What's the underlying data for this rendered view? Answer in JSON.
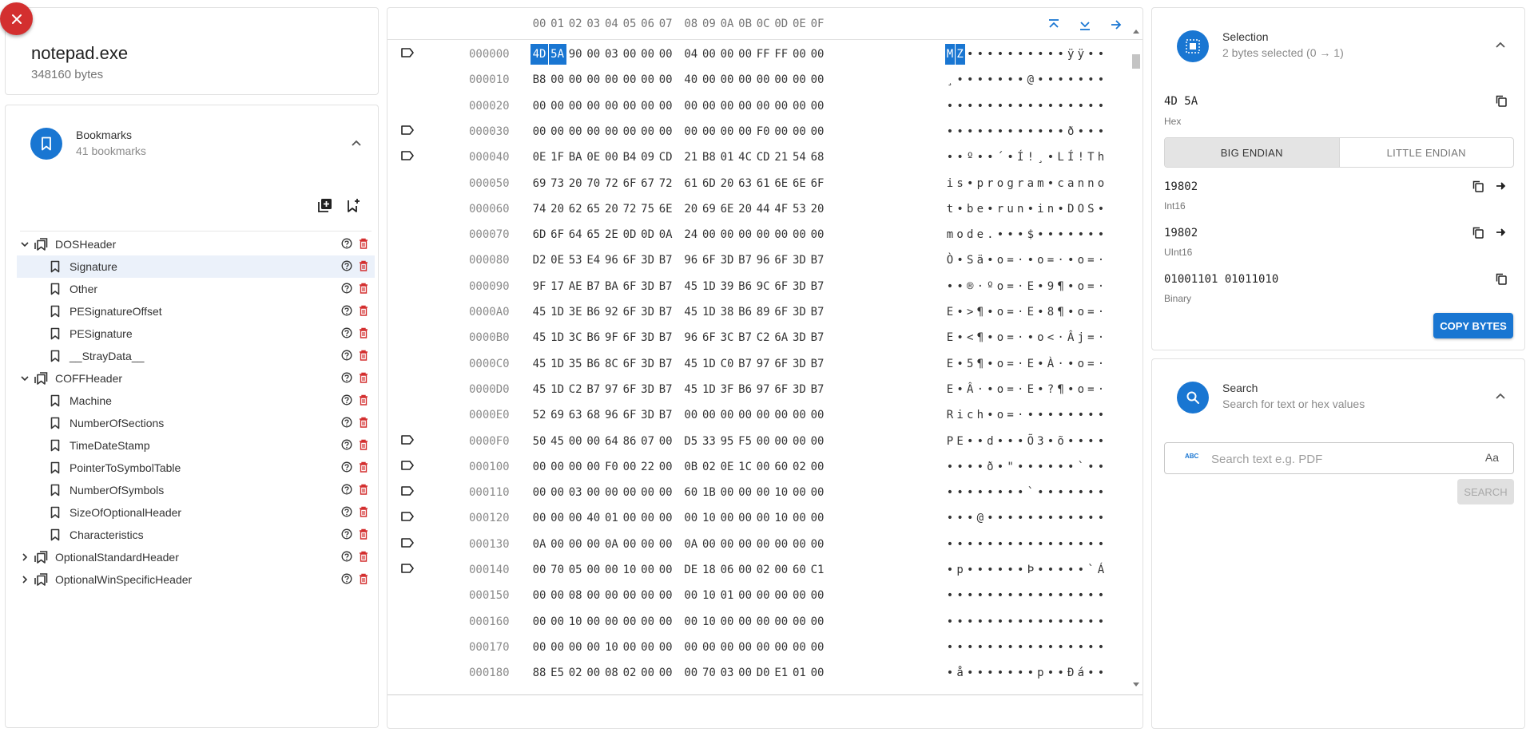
{
  "file": {
    "name": "notepad.exe",
    "size": "348160 bytes"
  },
  "bookmarks": {
    "title": "Bookmarks",
    "count": "41 bookmarks",
    "tree": [
      {
        "label": "DOSHeader",
        "level": 0,
        "expanded": true,
        "group": true
      },
      {
        "label": "Signature",
        "level": 1,
        "selected": true
      },
      {
        "label": "Other",
        "level": 1
      },
      {
        "label": "PESignatureOffset",
        "level": 1
      },
      {
        "label": "PESignature",
        "level": 1
      },
      {
        "label": "__StrayData__",
        "level": 1
      },
      {
        "label": "COFFHeader",
        "level": 0,
        "expanded": true,
        "group": true
      },
      {
        "label": "Machine",
        "level": 1
      },
      {
        "label": "NumberOfSections",
        "level": 1
      },
      {
        "label": "TimeDateStamp",
        "level": 1
      },
      {
        "label": "PointerToSymbolTable",
        "level": 1
      },
      {
        "label": "NumberOfSymbols",
        "level": 1
      },
      {
        "label": "SizeOfOptionalHeader",
        "level": 1
      },
      {
        "label": "Characteristics",
        "level": 1
      },
      {
        "label": "OptionalStandardHeader",
        "level": 0,
        "expanded": false,
        "group": true
      },
      {
        "label": "OptionalWinSpecificHeader",
        "level": 0,
        "expanded": false,
        "group": true
      }
    ]
  },
  "hex": {
    "columns": [
      "00",
      "01",
      "02",
      "03",
      "04",
      "05",
      "06",
      "07",
      "08",
      "09",
      "0A",
      "0B",
      "0C",
      "0D",
      "0E",
      "0F"
    ],
    "rows": [
      {
        "offset": "000000",
        "flag": true,
        "bytes": "4D 5A 90 00 03 00 00 00 04 00 00 00 FF FF 00 00",
        "ascii": "MZ••••••••••ÿÿ••"
      },
      {
        "offset": "000010",
        "flag": false,
        "bytes": "B8 00 00 00 00 00 00 00 40 00 00 00 00 00 00 00",
        "ascii": "¸•••••••@•••••••"
      },
      {
        "offset": "000020",
        "flag": false,
        "bytes": "00 00 00 00 00 00 00 00 00 00 00 00 00 00 00 00",
        "ascii": "••••••••••••••••"
      },
      {
        "offset": "000030",
        "flag": true,
        "bytes": "00 00 00 00 00 00 00 00 00 00 00 00 F0 00 00 00",
        "ascii": "••••••••••••ð•••"
      },
      {
        "offset": "000040",
        "flag": true,
        "bytes": "0E 1F BA 0E 00 B4 09 CD 21 B8 01 4C CD 21 54 68",
        "ascii": "••º••´•Í!¸•LÍ!Th"
      },
      {
        "offset": "000050",
        "flag": false,
        "bytes": "69 73 20 70 72 6F 67 72 61 6D 20 63 61 6E 6E 6F",
        "ascii": "is•program•canno"
      },
      {
        "offset": "000060",
        "flag": false,
        "bytes": "74 20 62 65 20 72 75 6E 20 69 6E 20 44 4F 53 20",
        "ascii": "t•be•run•in•DOS•"
      },
      {
        "offset": "000070",
        "flag": false,
        "bytes": "6D 6F 64 65 2E 0D 0D 0A 24 00 00 00 00 00 00 00",
        "ascii": "mode.•••$•••••••"
      },
      {
        "offset": "000080",
        "flag": false,
        "bytes": "D2 0E 53 E4 96 6F 3D B7 96 6F 3D B7 96 6F 3D B7",
        "ascii": "Ò•Sä•o=·•o=·•o=·"
      },
      {
        "offset": "000090",
        "flag": false,
        "bytes": "9F 17 AE B7 BA 6F 3D B7 45 1D 39 B6 9C 6F 3D B7",
        "ascii": "••®·ºo=·E•9¶•o=·"
      },
      {
        "offset": "0000A0",
        "flag": false,
        "bytes": "45 1D 3E B6 92 6F 3D B7 45 1D 38 B6 89 6F 3D B7",
        "ascii": "E•>¶•o=·E•8¶•o=·"
      },
      {
        "offset": "0000B0",
        "flag": false,
        "bytes": "45 1D 3C B6 9F 6F 3D B7 96 6F 3C B7 C2 6A 3D B7",
        "ascii": "E•<¶•o=·•o<·Âj=·"
      },
      {
        "offset": "0000C0",
        "flag": false,
        "bytes": "45 1D 35 B6 8C 6F 3D B7 45 1D C0 B7 97 6F 3D B7",
        "ascii": "E•5¶•o=·E•À·•o=·"
      },
      {
        "offset": "0000D0",
        "flag": false,
        "bytes": "45 1D C2 B7 97 6F 3D B7 45 1D 3F B6 97 6F 3D B7",
        "ascii": "E•Â·•o=·E•?¶•o=·"
      },
      {
        "offset": "0000E0",
        "flag": false,
        "bytes": "52 69 63 68 96 6F 3D B7 00 00 00 00 00 00 00 00",
        "ascii": "Rich•o=·••••••••"
      },
      {
        "offset": "0000F0",
        "flag": true,
        "bytes": "50 45 00 00 64 86 07 00 D5 33 95 F5 00 00 00 00",
        "ascii": "PE••d•••Õ3•õ••••"
      },
      {
        "offset": "000100",
        "flag": true,
        "bytes": "00 00 00 00 F0 00 22 00 0B 02 0E 1C 00 60 02 00",
        "ascii": "••••ð•\"••••••`••"
      },
      {
        "offset": "000110",
        "flag": true,
        "bytes": "00 00 03 00 00 00 00 00 60 1B 00 00 00 10 00 00",
        "ascii": "••••••••`•••••••"
      },
      {
        "offset": "000120",
        "flag": true,
        "bytes": "00 00 00 40 01 00 00 00 00 10 00 00 00 10 00 00",
        "ascii": "•••@••••••••••••"
      },
      {
        "offset": "000130",
        "flag": true,
        "bytes": "0A 00 00 00 0A 00 00 00 0A 00 00 00 00 00 00 00",
        "ascii": "••••••••••••••••"
      },
      {
        "offset": "000140",
        "flag": true,
        "bytes": "00 70 05 00 00 10 00 00 DE 18 06 00 02 00 60 C1",
        "ascii": "•p••••••Þ•••••`Á"
      },
      {
        "offset": "000150",
        "flag": false,
        "bytes": "00 00 08 00 00 00 00 00 00 10 01 00 00 00 00 00",
        "ascii": "••••••••••••••••"
      },
      {
        "offset": "000160",
        "flag": false,
        "bytes": "00 00 10 00 00 00 00 00 00 10 00 00 00 00 00 00",
        "ascii": "••••••••••••••••"
      },
      {
        "offset": "000170",
        "flag": false,
        "bytes": "00 00 00 00 10 00 00 00 00 00 00 00 00 00 00 00",
        "ascii": "••••••••••••••••"
      },
      {
        "offset": "000180",
        "flag": false,
        "bytes": "88 E5 02 00 08 02 00 00 00 70 03 00 D0 E1 01 00",
        "ascii": "•å•••••••p••Ðá••"
      }
    ]
  },
  "selection": {
    "title": "Selection",
    "summary": "2 bytes selected (0 → 1)",
    "hex_value": "4D 5A",
    "hex_label": "Hex",
    "endian_big": "BIG ENDIAN",
    "endian_little": "LITTLE ENDIAN",
    "int16_value": "19802",
    "int16_label": "Int16",
    "uint16_value": "19802",
    "uint16_label": "UInt16",
    "binary_value": "01001101 01011010",
    "binary_label": "Binary",
    "copy_bytes": "COPY BYTES"
  },
  "search": {
    "title": "Search",
    "subtitle": "Search for text or hex values",
    "placeholder": "Search text e.g. PDF",
    "case_toggle": "Aa",
    "button": "SEARCH",
    "abc_glyph": "ABC"
  },
  "colors": {
    "accent": "#1976d2",
    "danger": "#d32f2f",
    "selected_row": "#ebf1fa"
  },
  "icons": {
    "close": "close-icon",
    "bookmark": "bookmark-icon",
    "bookmarks_group": "bookmarks-group-icon",
    "help": "help-circle-icon",
    "delete": "trash-icon",
    "copy": "copy-icon",
    "arrow": "arrow-right-icon"
  }
}
